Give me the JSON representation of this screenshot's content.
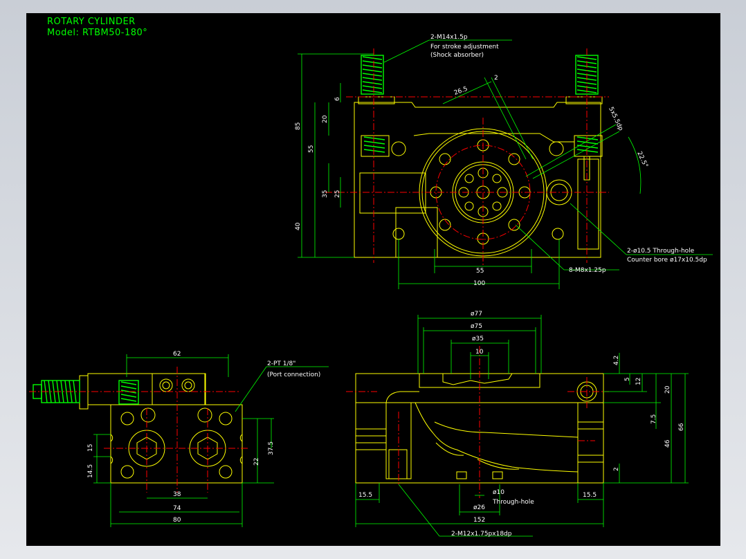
{
  "title": {
    "line1": "ROTARY CYLINDER",
    "line2": "Model: RTBM50-180°"
  },
  "top_view": {
    "callout_port": [
      "2-M14x1.5p",
      "For stroke adjustment",
      "(Shock absorber)"
    ],
    "dims": {
      "d85": "85",
      "d55": "55",
      "d20": "20",
      "d6": "6",
      "d35": "35",
      "d25": "25",
      "d40": "40",
      "d26_5": "26.5",
      "d2": "2",
      "d5x5": "5x5.5dp",
      "d22_5": "22.5°",
      "d55_bottom": "55",
      "d100": "100"
    },
    "callout_hole": [
      "2-ø10.5 Through-hole",
      "Counter bore ø17x10.5dp"
    ],
    "callout_tap": "8-M8x1.25p"
  },
  "side_view": {
    "callout_port": [
      "2-PT 1/8\"",
      "(Port connection)"
    ],
    "dims": {
      "d62": "62",
      "d15": "15",
      "d14_5": "14.5",
      "d37_5": "37.5",
      "d22": "22",
      "d38": "38",
      "d74": "74",
      "d80": "80"
    }
  },
  "front_view": {
    "dims": {
      "d77": "ø77",
      "d75": "ø75",
      "d35": "ø35",
      "d10": "10",
      "d4_2": "4.2",
      "d5": "5",
      "d12": "12",
      "d20": "20",
      "d7_5": "7.5",
      "d46": "46",
      "d66": "66",
      "d2": "2",
      "d15_5l": "15.5",
      "d15_5r": "15.5",
      "d152": "152",
      "d26": "ø26",
      "d10b": "ø10"
    },
    "through_hole": "Through-hole",
    "callout_tap": "2-M12x1.75px18dp"
  },
  "colors": {
    "background": "#000000",
    "outline": "#ffff00",
    "dimension": "#00ff00",
    "centerline": "#ff0000",
    "text": "#ffffff",
    "thread": "#00ff00",
    "hidden": "#00ffff"
  }
}
